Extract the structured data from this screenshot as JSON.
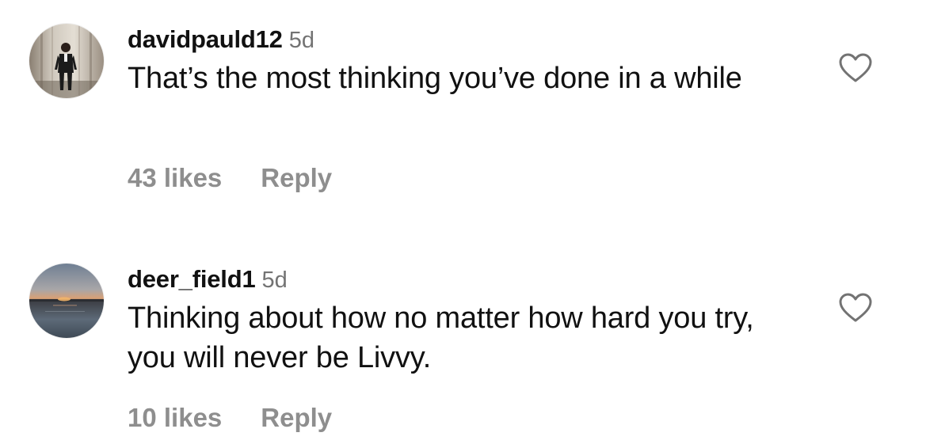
{
  "comments": [
    {
      "username": "davidpauld12",
      "timestamp": "5d",
      "text": "That’s the most thinking you’ve done in a while",
      "likes": "43 likes",
      "reply_label": "Reply",
      "avatar_icon": "person-in-suit-avatar",
      "like_icon": "heart-outline-icon"
    },
    {
      "username": "deer_field1",
      "timestamp": "5d",
      "text": "Thinking about how no matter how hard you try, you will never be Livvy.",
      "likes": "10 likes",
      "reply_label": "Reply",
      "avatar_icon": "sunset-over-water-avatar",
      "like_icon": "heart-outline-icon"
    }
  ],
  "colors": {
    "text_primary": "#111111",
    "text_secondary": "#737373",
    "action_gray": "#8e8e8e",
    "background": "#ffffff"
  }
}
